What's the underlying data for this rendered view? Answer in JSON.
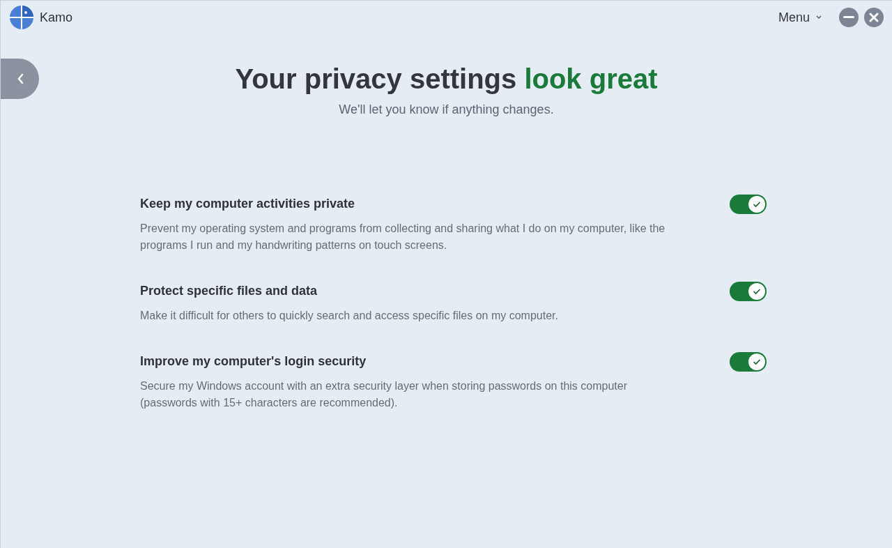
{
  "app": {
    "name": "Kamo"
  },
  "menu": {
    "label": "Menu"
  },
  "heading": {
    "text": "Your privacy settings",
    "highlight": "look great",
    "subtitle": "We'll let you know if anything changes."
  },
  "settings": [
    {
      "title": "Keep my computer activities private",
      "description": "Prevent my operating system and programs from collecting and sharing what I do on my computer, like the programs I run and my handwriting patterns on touch screens.",
      "on": true
    },
    {
      "title": "Protect specific files and data",
      "description": "Make it difficult for others to quickly search and access specific files on my computer.",
      "on": true
    },
    {
      "title": "Improve my computer's login security",
      "description": "Secure my Windows account with an extra security layer when storing passwords on this computer (passwords with 15+ characters are recommended).",
      "on": true
    }
  ]
}
